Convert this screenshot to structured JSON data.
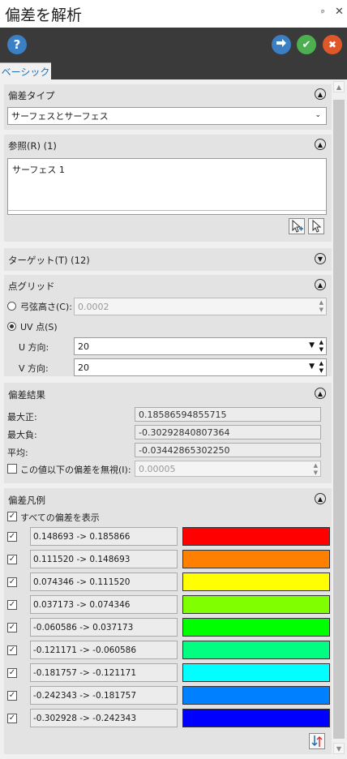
{
  "window": {
    "title": "偏差を解析",
    "pin": "ᵖ",
    "close": "✕"
  },
  "toolbar": {
    "help": "?",
    "ok": "✔",
    "cancel": "✖"
  },
  "tab": {
    "label": "ベーシック"
  },
  "deviation_type": {
    "header": "偏差タイプ",
    "selected": "サーフェスとサーフェス"
  },
  "reference": {
    "header": "参照(R) (1)",
    "items": [
      "サーフェス 1"
    ]
  },
  "target": {
    "header": "ターゲット(T) (12)"
  },
  "point_grid": {
    "header": "点グリッド",
    "chord_label": "弓弦高さ(C):",
    "chord_value": "0.0002",
    "uv_label": "UV 点(S)",
    "u_label": "U 方向:",
    "u_value": "20",
    "v_label": "V 方向:",
    "v_value": "20"
  },
  "results": {
    "header": "偏差結果",
    "max_pos_label": "最大正:",
    "max_pos": "0.18586594855715",
    "max_neg_label": "最大負:",
    "max_neg": "-0.30292840807364",
    "avg_label": "平均:",
    "avg": "-0.03442865302250",
    "ignore_label": "この値以下の偏差を無視(I):",
    "ignore_value": "0.00005"
  },
  "legend": {
    "header": "偏差凡例",
    "show_all": "すべての偏差を表示",
    "rows": [
      {
        "range": "0.148693 -> 0.185866",
        "color": "#ff0000"
      },
      {
        "range": "0.111520 -> 0.148693",
        "color": "#ff8000"
      },
      {
        "range": "0.074346 -> 0.111520",
        "color": "#ffff00"
      },
      {
        "range": "0.037173 -> 0.074346",
        "color": "#80ff00"
      },
      {
        "range": "-0.060586 -> 0.037173",
        "color": "#00ff00"
      },
      {
        "range": "-0.121171 -> -0.060586",
        "color": "#00ff80"
      },
      {
        "range": "-0.181757 -> -0.121171",
        "color": "#00ffff"
      },
      {
        "range": "-0.242343 -> -0.181757",
        "color": "#0080ff"
      },
      {
        "range": "-0.302928 -> -0.242343",
        "color": "#0000ff"
      }
    ]
  }
}
